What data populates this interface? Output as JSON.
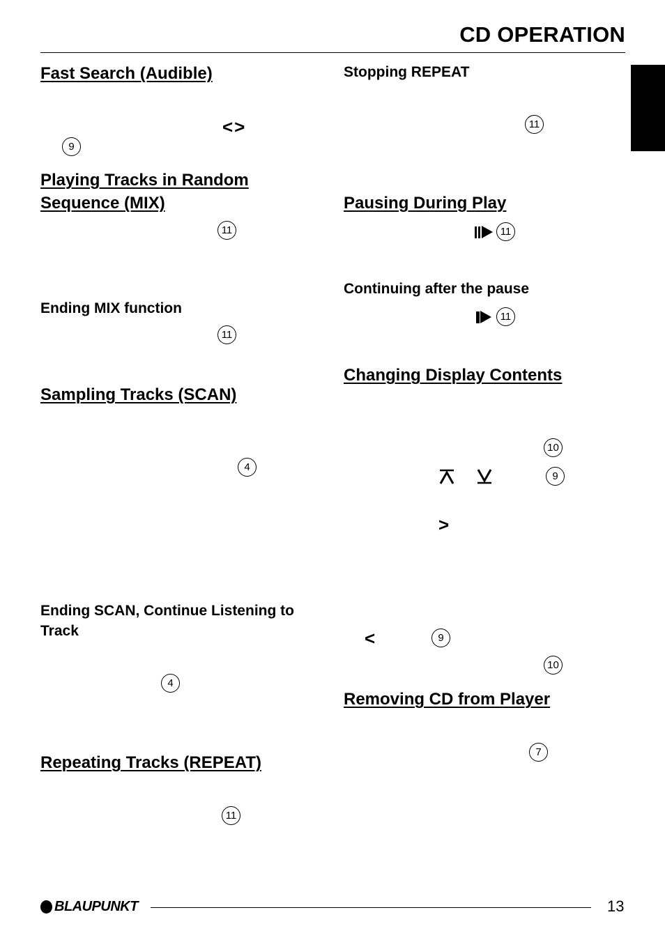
{
  "header": {
    "title": "CD OPERATION"
  },
  "left_column": {
    "fast_search": {
      "heading": "Fast Search (Audible)",
      "icon": "left-right-arrows-icon",
      "icon_glyph": "<>",
      "ref": "9"
    },
    "mix": {
      "heading_line1": "Playing Tracks in Random",
      "heading_line2": "Sequence (MIX)",
      "ref": "11"
    },
    "ending_mix": {
      "heading": "Ending MIX function",
      "ref": "11"
    },
    "scan": {
      "heading": "Sampling Tracks (SCAN)",
      "ref": "4"
    },
    "ending_scan": {
      "heading_line1": "Ending SCAN, Continue Listening to",
      "heading_line2": "Track",
      "ref": "4"
    },
    "repeat": {
      "heading": "Repeating Tracks (REPEAT)",
      "ref": "11"
    }
  },
  "right_column": {
    "stopping_repeat": {
      "heading": "Stopping REPEAT",
      "ref": "11"
    },
    "pausing": {
      "heading": "Pausing During Play",
      "icon": "play-pause-icon",
      "ref": "11"
    },
    "continuing": {
      "heading": "Continuing after the pause",
      "icon": "play-pause-icon",
      "ref": "11"
    },
    "display": {
      "heading": "Changing Display Contents",
      "ref_top": "10",
      "up_icon": "up-arrow-bar-icon",
      "down_icon": "down-arrow-bar-icon",
      "ref_arrows": "9",
      "right_glyph": ">",
      "left_glyph": "<",
      "ref_left": "9",
      "ref_bottom": "10"
    },
    "removing": {
      "heading": "Removing CD from Player",
      "ref": "7"
    }
  },
  "footer": {
    "brand": "BLAUPUNKT",
    "page_number": "13"
  }
}
